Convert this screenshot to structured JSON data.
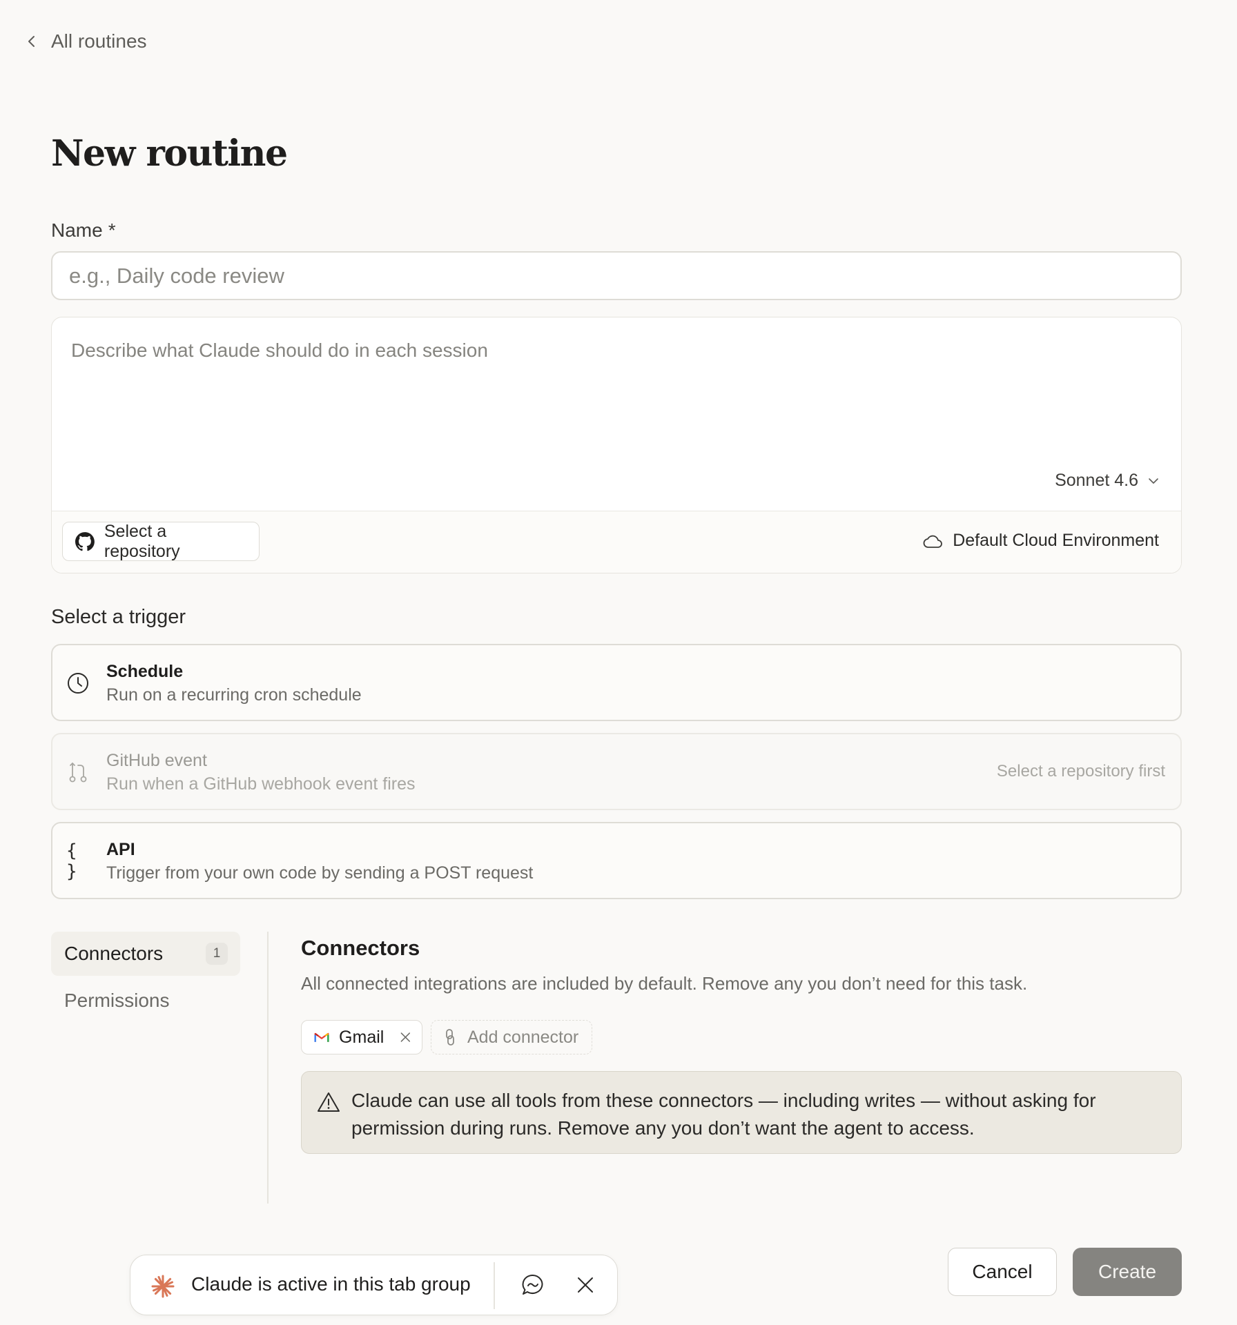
{
  "nav": {
    "back_label": "All routines"
  },
  "page": {
    "title": "New routine"
  },
  "form": {
    "name_label": "Name",
    "required_marker": "*",
    "name_value": "",
    "name_placeholder": "e.g., Daily code review",
    "prompt_value": "",
    "prompt_placeholder": "Describe what Claude should do in each session",
    "model": "Sonnet 4.6",
    "repo_button_label": "Select a repository",
    "environment": "Default Cloud Environment"
  },
  "triggers": {
    "heading": "Select a trigger",
    "items": [
      {
        "title": "Schedule",
        "description": "Run on a recurring cron schedule",
        "icon": "clock-icon",
        "enabled": true
      },
      {
        "title": "GitHub event",
        "description": "Run when a GitHub webhook event fires",
        "icon": "git-branch-icon",
        "enabled": false,
        "note": "Select a repository first"
      },
      {
        "title": "API",
        "description": "Trigger from your own code by sending a POST request",
        "icon": "braces-icon",
        "glyph": "{ }",
        "enabled": true
      }
    ]
  },
  "sidebar": {
    "items": [
      {
        "label": "Connectors",
        "badge": "1",
        "active": true
      },
      {
        "label": "Permissions",
        "active": false
      }
    ]
  },
  "connectors": {
    "title": "Connectors",
    "description": "All connected integrations are included by default. Remove any you don’t need for this task.",
    "chips": [
      {
        "label": "Gmail",
        "icon": "gmail-icon"
      }
    ],
    "add_label": "Add connector",
    "warning": "Claude can use all tools from these connectors — including writes — without asking for permission during runs. Remove any you don’t want the agent to access."
  },
  "claude_bar": {
    "text": "Claude is active in this tab group"
  },
  "actions": {
    "cancel_label": "Cancel",
    "create_label": "Create"
  },
  "colors": {
    "background": "#faf9f7",
    "create_button": "#858480",
    "warning_bg": "#ece9e1",
    "claude_accent": "#d97757"
  }
}
